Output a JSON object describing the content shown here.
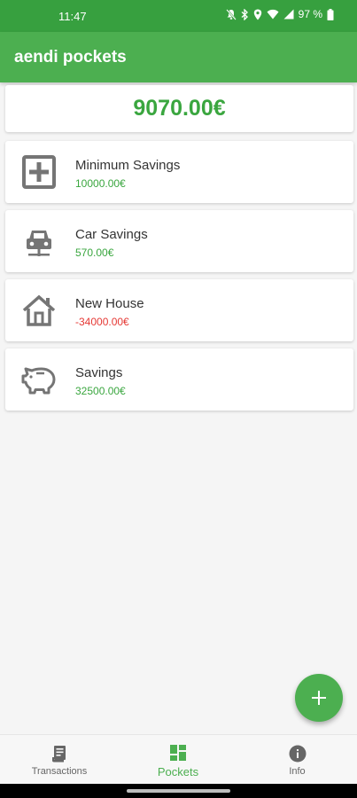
{
  "status_bar": {
    "time": "11:47",
    "battery_percent": "97 %",
    "icons": [
      "mute-icon",
      "bluetooth-icon",
      "location-icon",
      "wifi-icon",
      "signal-icon",
      "battery-icon"
    ]
  },
  "app_bar": {
    "title": "aendi pockets"
  },
  "total": {
    "amount": "9070.00€"
  },
  "pockets": [
    {
      "icon": "medical-box-icon",
      "name": "Minimum Savings",
      "amount": "10000.00€"
    },
    {
      "icon": "car-icon",
      "name": "Car Savings",
      "amount": "570.00€"
    },
    {
      "icon": "house-icon",
      "name": "New House",
      "amount": "-34000.00€"
    },
    {
      "icon": "piggy-bank-icon",
      "name": "Savings",
      "amount": "32500.00€"
    }
  ],
  "fab": {
    "icon": "plus-icon"
  },
  "bottom_nav": [
    {
      "icon": "receipt-icon",
      "label": "Transactions",
      "active": false
    },
    {
      "icon": "dashboard-icon",
      "label": "Pockets",
      "active": true
    },
    {
      "icon": "info-icon",
      "label": "Info",
      "active": false
    }
  ],
  "colors": {
    "primary": "#4caf50",
    "status_bar": "#37a03f",
    "positive": "#3aa63f",
    "negative": "#e53935",
    "background": "#f5f5f5"
  }
}
